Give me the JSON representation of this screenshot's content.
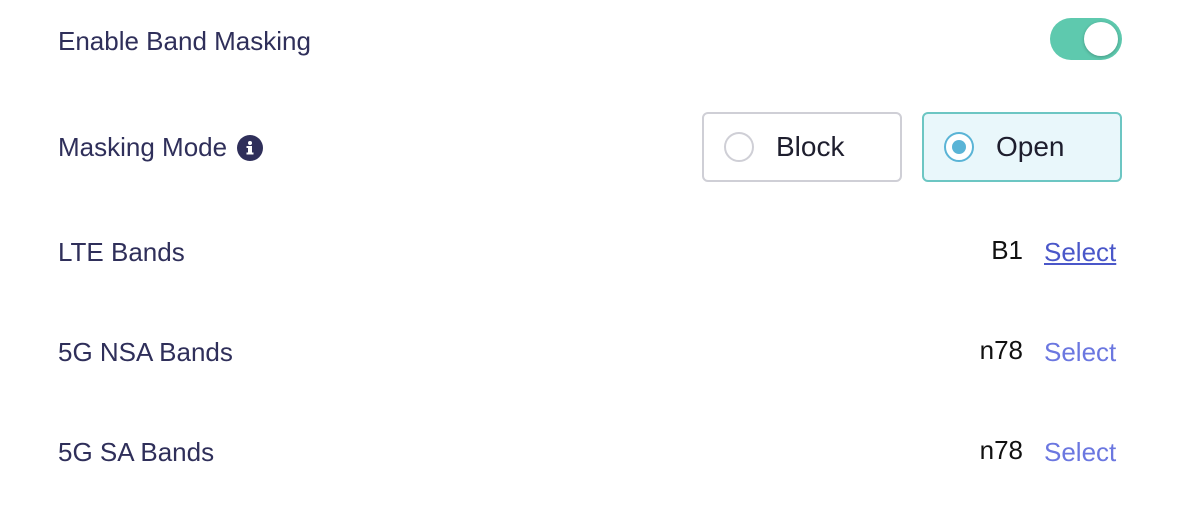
{
  "band_masking": {
    "label": "Enable Band Masking",
    "enabled": true,
    "toggle_color": "#5ec9ae"
  },
  "masking_mode": {
    "label": "Masking Mode",
    "info_icon": "info-icon",
    "options": [
      {
        "label": "Block",
        "selected": false
      },
      {
        "label": "Open",
        "selected": true
      }
    ]
  },
  "bands": [
    {
      "label": "LTE Bands",
      "value": "B1",
      "action": "Select"
    },
    {
      "label": "5G NSA Bands",
      "value": "n78",
      "action": "Select"
    },
    {
      "label": "5G SA Bands",
      "value": "n78",
      "action": "Select"
    }
  ]
}
